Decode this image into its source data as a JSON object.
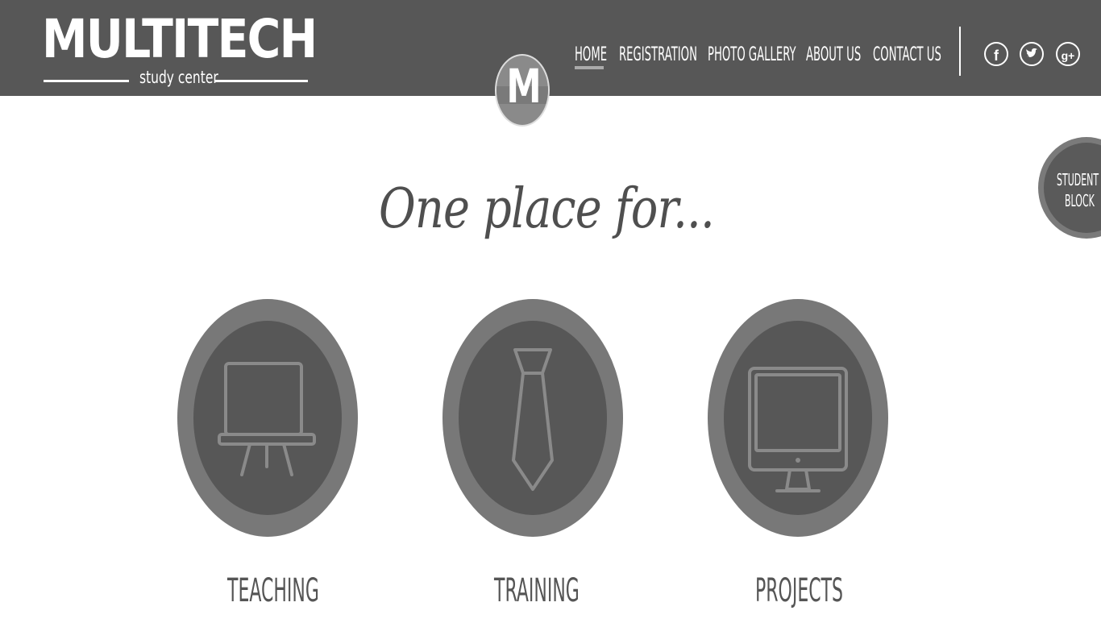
{
  "logo": {
    "title": "MULTITECH",
    "subtitle": "study center"
  },
  "nav": {
    "items": [
      "HOME",
      "REGISTRATION",
      "PHOTO GALLERY",
      "ABOUT US",
      "CONTACT US"
    ],
    "active": "HOME"
  },
  "social": [
    "facebook-icon",
    "twitter-icon",
    "google-plus-icon"
  ],
  "badge": {
    "letter": "M"
  },
  "student_block": {
    "line1": "STUDENT",
    "line2": "BLOCK"
  },
  "tagline": "One place for...",
  "features": [
    {
      "label": "TEACHING",
      "icon": "easel-board-icon"
    },
    {
      "label": "TRAINING",
      "icon": "necktie-icon"
    },
    {
      "label": "PROJECTS",
      "icon": "monitor-icon"
    }
  ],
  "colors": {
    "header": "#575757",
    "ring": "#787878",
    "inner": "#575757",
    "icon_stroke": "#8a8a8a"
  }
}
